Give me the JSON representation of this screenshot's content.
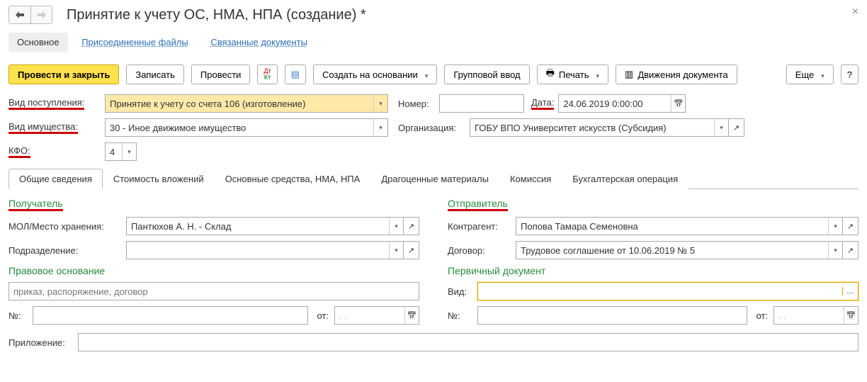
{
  "header": {
    "title": "Принятие к учету ОС, НМА, НПА (создание) *"
  },
  "linkTabs": {
    "main": "Основное",
    "attached": "Присоединенные файлы",
    "related": "Связанные документы"
  },
  "toolbar": {
    "postClose": "Провести и закрыть",
    "save": "Записать",
    "post": "Провести",
    "createBased": "Создать на основании",
    "groupInput": "Групповой ввод",
    "print": "Печать",
    "movements": "Движения документа",
    "more": "Еще",
    "help": "?"
  },
  "form": {
    "receiptTypeLabel": "Вид поступления:",
    "receiptType": "Принятие к учету со счета 106 (изготовление)",
    "numberLabel": "Номер:",
    "number": "",
    "dateLabel": "Дата:",
    "date": "24.06.2019  0:00:00",
    "assetTypeLabel": "Вид имущества:",
    "assetType": "30 - Иное движимое имущество",
    "orgLabel": "Организация:",
    "org": "ГОБУ ВПО Университет искусств (Субсидия)",
    "kfoLabel": "КФО:",
    "kfo": "4"
  },
  "tabs": [
    "Общие сведения",
    "Стоимость вложений",
    "Основные средства, НМА, НПА",
    "Драгоценные материалы",
    "Комиссия",
    "Бухгалтерская операция"
  ],
  "recipient": {
    "title": "Получатель",
    "molLabel": "МОЛ/Место хранения:",
    "mol": "Пантюхов А. Н. - Склад",
    "deptLabel": "Подразделение:",
    "dept": "",
    "legalBasisTitle": "Правовое основание",
    "legalBasisPlaceholder": "приказ, распоряжение, договор",
    "noLabel": "№:",
    "fromLabel": "от:",
    "datePlaceholder": "  .  .    "
  },
  "sender": {
    "title": "Отправитель",
    "counterpartyLabel": "Контрагент:",
    "counterparty": "Попова Тамара Семеновна",
    "contractLabel": "Договор:",
    "contract": "Трудовое соглашение от 10.06.2019 № 5",
    "primaryDocTitle": "Первичный документ",
    "typeLabel": "Вид:",
    "noLabel": "№:",
    "fromLabel": "от:",
    "datePlaceholder": "  .  .    "
  },
  "attachment": {
    "label": "Приложение:"
  }
}
